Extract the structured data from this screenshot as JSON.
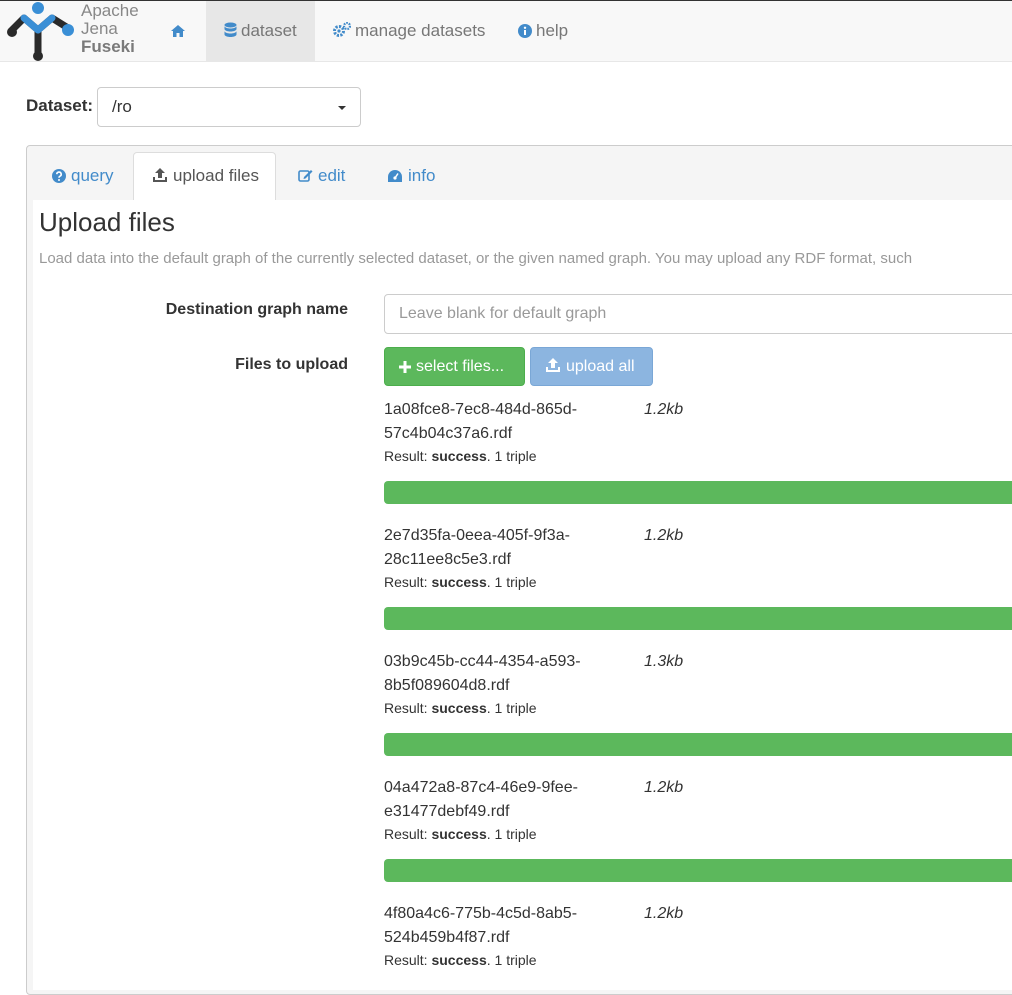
{
  "nav": {
    "logo_line1": "Apache",
    "logo_line2": "Jena",
    "logo_line3": "Fuseki",
    "home_icon": "home-icon",
    "dataset_label": "dataset",
    "manage_label": "manage datasets",
    "help_label": "help"
  },
  "dataset": {
    "label": "Dataset:",
    "selected": "/ro"
  },
  "tabs": {
    "query": "query",
    "upload": "upload files",
    "edit": "edit",
    "info": "info"
  },
  "upload": {
    "title": "Upload files",
    "description": "Load data into the default graph of the currently selected dataset, or the given named graph. You may upload any RDF format, such",
    "dest_label": "Destination graph name",
    "dest_placeholder": "Leave blank for default graph",
    "files_label": "Files to upload",
    "select_button": "select files...",
    "upload_all_button": "upload all"
  },
  "files": [
    {
      "name": "1a08fce8-7ec8-484d-865d-57c4b04c37a6.rdf",
      "size": "1.2kb",
      "result_prefix": "Result: ",
      "result_status": "success",
      "result_suffix": ". 1 triple",
      "progress": 1.0
    },
    {
      "name": "2e7d35fa-0eea-405f-9f3a-28c11ee8c5e3.rdf",
      "size": "1.2kb",
      "result_prefix": "Result: ",
      "result_status": "success",
      "result_suffix": ". 1 triple",
      "progress": 1.0
    },
    {
      "name": "03b9c45b-cc44-4354-a593-8b5f089604d8.rdf",
      "size": "1.3kb",
      "result_prefix": "Result: ",
      "result_status": "success",
      "result_suffix": ". 1 triple",
      "progress": 1.0
    },
    {
      "name": "04a472a8-87c4-46e9-9fee-e31477debf49.rdf",
      "size": "1.2kb",
      "result_prefix": "Result: ",
      "result_status": "success",
      "result_suffix": ". 1 triple",
      "progress": 1.0
    },
    {
      "name": "4f80a4c6-775b-4c5d-8ab5-524b459b4f87.rdf",
      "size": "1.2kb",
      "result_prefix": "Result: ",
      "result_status": "success",
      "result_suffix": ". 1 triple",
      "progress": 1.0
    }
  ],
  "colors": {
    "link": "#428bca",
    "success": "#5cb85c",
    "primary_light": "#8cb5e0"
  }
}
